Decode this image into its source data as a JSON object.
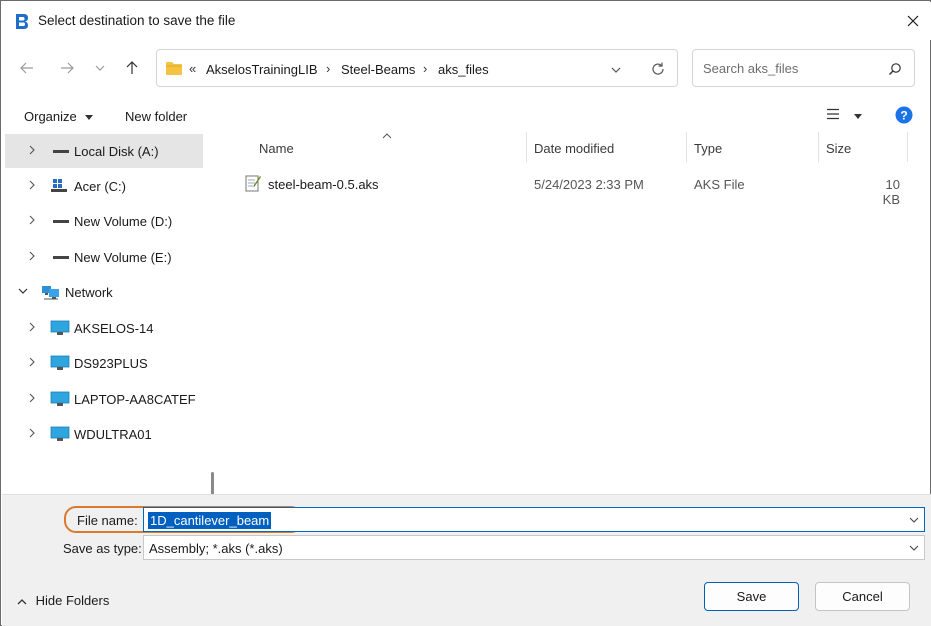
{
  "window": {
    "title": "Select destination to save the file",
    "close_icon": "close-icon"
  },
  "nav": {
    "breadcrumb": [
      "AkselosTrainingLIB",
      "Steel-Beams",
      "aks_files"
    ],
    "overflow": "«",
    "search_placeholder": "Search aks_files"
  },
  "toolbar": {
    "organize_label": "Organize",
    "new_folder_label": "New folder"
  },
  "sidebar": {
    "items": [
      {
        "label": "Local Disk (A:)",
        "icon": "drive-icon",
        "selected": true
      },
      {
        "label": "Acer (C:)",
        "icon": "windows-drive-icon",
        "selected": false
      },
      {
        "label": "New Volume (D:)",
        "icon": "drive-icon",
        "selected": false
      },
      {
        "label": "New Volume (E:)",
        "icon": "drive-icon",
        "selected": false
      },
      {
        "label": "Network",
        "icon": "network-icon",
        "selected": false,
        "expanded": true
      },
      {
        "label": "AKSELOS-14",
        "icon": "computer-icon",
        "selected": false
      },
      {
        "label": "DS923PLUS",
        "icon": "computer-icon",
        "selected": false
      },
      {
        "label": "LAPTOP-AA8CATEF",
        "icon": "computer-icon",
        "selected": false
      },
      {
        "label": "WDULTRA01",
        "icon": "computer-icon",
        "selected": false
      }
    ]
  },
  "filelist": {
    "columns": [
      "Name",
      "Date modified",
      "Type",
      "Size"
    ],
    "rows": [
      {
        "name": "steel-beam-0.5.aks",
        "date": "5/24/2023 2:33 PM",
        "type": "AKS File",
        "size": "10 KB"
      }
    ]
  },
  "form": {
    "file_name_label": "File name:",
    "file_name_value": "1D_cantilever_beam",
    "save_type_label": "Save as type:",
    "save_type_value": "Assembly; *.aks (*.aks)"
  },
  "footer": {
    "hide_folders_label": "Hide Folders",
    "save_label": "Save",
    "cancel_label": "Cancel"
  },
  "colors": {
    "accent": "#005fb8",
    "selection": "#0060c0",
    "highlight_ring": "#d97a2c",
    "folder": "#f5c342",
    "help": "#1a73e8"
  }
}
